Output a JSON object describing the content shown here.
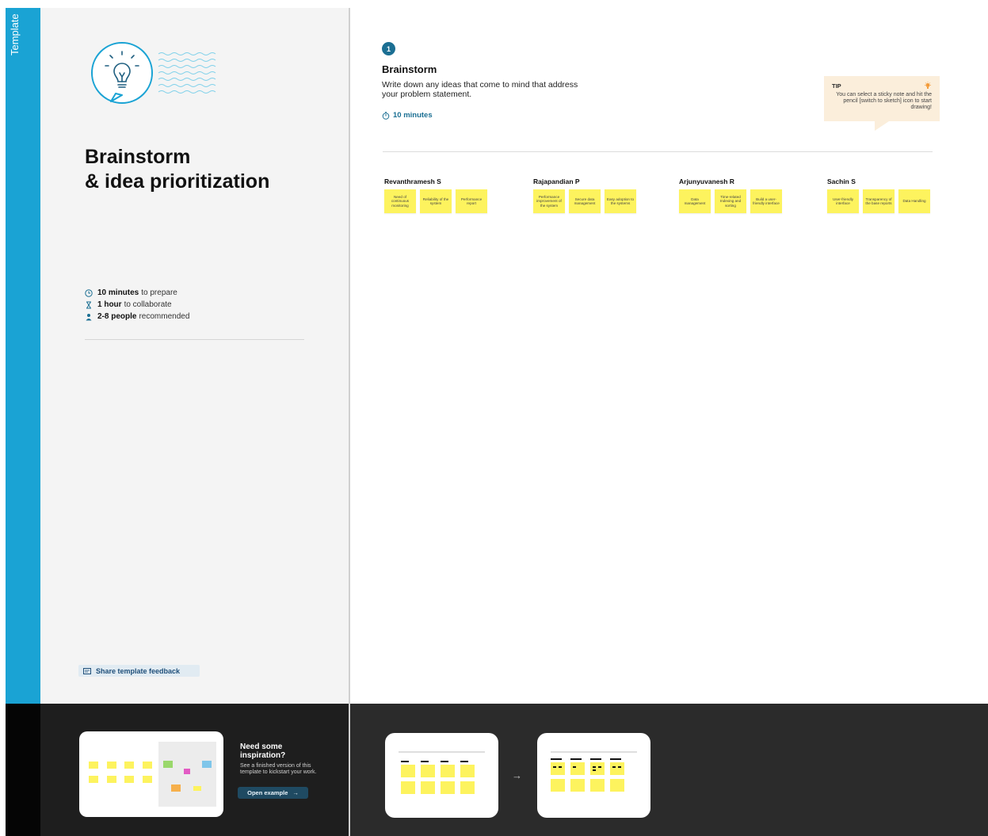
{
  "side_strip": {
    "label": "Template",
    "color": "#1aa3d4"
  },
  "left_panel": {
    "title_line1": "Brainstorm",
    "title_line2": "& idea prioritization",
    "meta": [
      {
        "icon": "clock-icon",
        "bold": "10 minutes",
        "rest": "to prepare"
      },
      {
        "icon": "hourglass-icon",
        "bold": "1 hour",
        "rest": "to collaborate"
      },
      {
        "icon": "person-icon",
        "bold": "2-8 people",
        "rest": "recommended"
      }
    ],
    "feedback_label": "Share template feedback"
  },
  "step": {
    "number": "1",
    "title": "Brainstorm",
    "description": "Write down any ideas that come to mind that address your problem statement.",
    "time": "10 minutes"
  },
  "tip": {
    "title": "TIP",
    "text": "You can select a sticky note and hit the pencil [switch to sketch] icon to start drawing!"
  },
  "people": [
    {
      "name": "Revanthramesh S",
      "notes": [
        "Need of continuous monitoring",
        "Reliability of the system",
        "Performance report"
      ]
    },
    {
      "name": "Rajapandian P",
      "notes": [
        "Performance improvement of the system",
        "Secure data management",
        "Easy adoption to the systems"
      ]
    },
    {
      "name": "Arjunyuvanesh R",
      "notes": [
        "Data management",
        "Time-related Indexing and sorting",
        "Build a user-friendly interface"
      ]
    },
    {
      "name": "Sachin S",
      "notes": [
        "User-friendly interface",
        "Transparency of the base reports",
        "Data Handling"
      ]
    }
  ],
  "inspiration": {
    "title": "Need some inspiration?",
    "text": "See a finished version of this template to kickstart your work.",
    "button_label": "Open example"
  },
  "colors": {
    "accent_blue": "#1aa3d4",
    "step_badge": "#1b6f93",
    "sticky_yellow": "#fdf35e",
    "tip_background": "#fbeedb"
  }
}
